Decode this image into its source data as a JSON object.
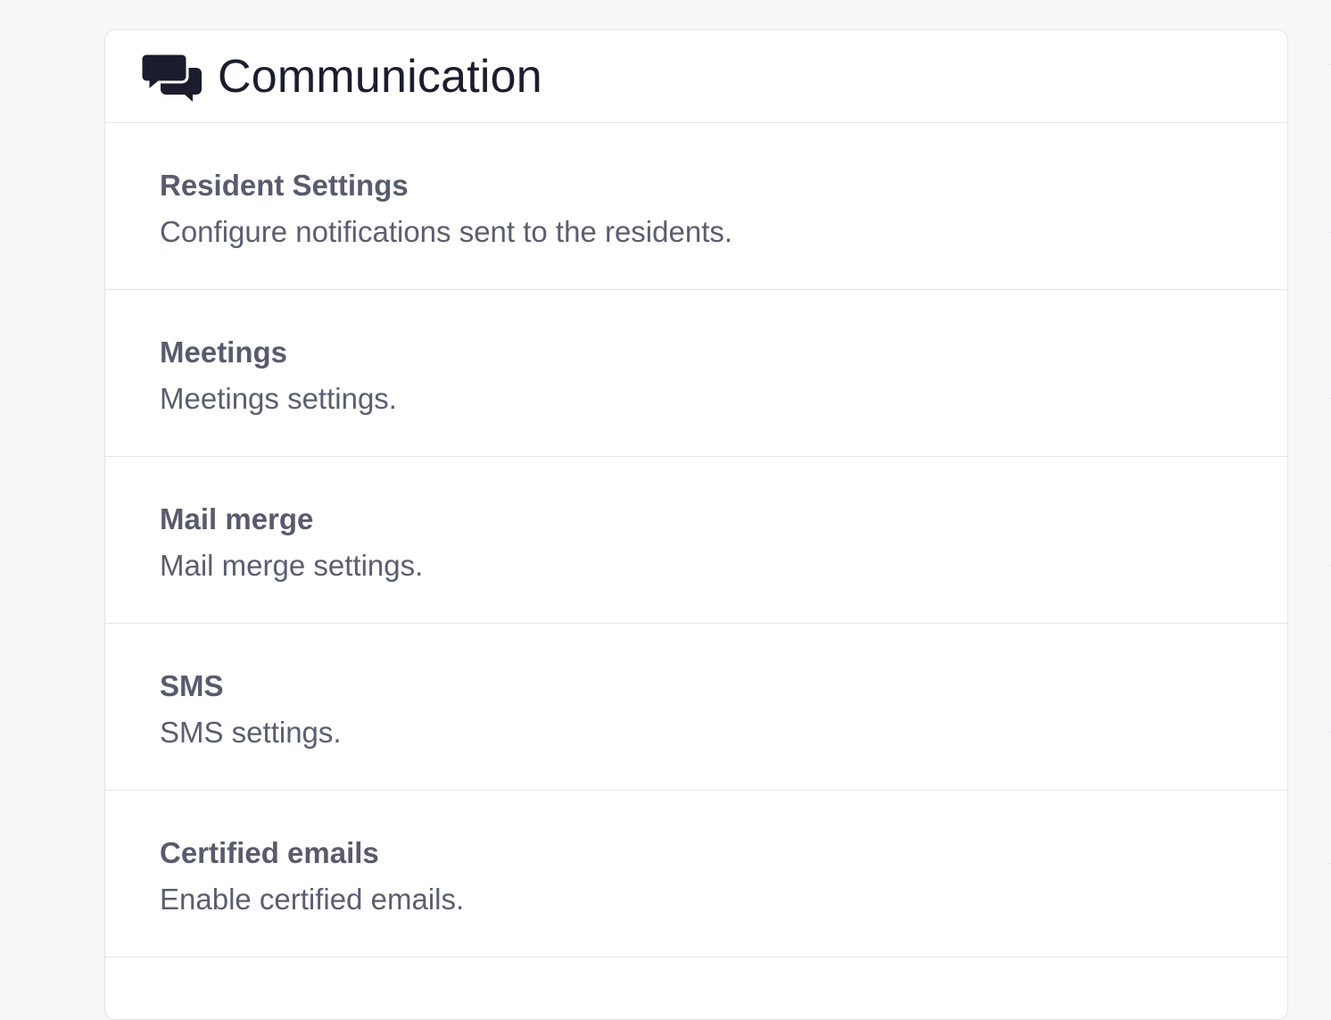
{
  "header": {
    "icon": "comments-icon",
    "title": "Communication"
  },
  "settings": [
    {
      "title": "Resident Settings",
      "description": "Configure notifications sent to the residents."
    },
    {
      "title": "Meetings",
      "description": "Meetings settings."
    },
    {
      "title": "Mail merge",
      "description": "Mail merge settings."
    },
    {
      "title": "SMS",
      "description": "SMS settings."
    },
    {
      "title": "Certified emails",
      "description": "Enable certified emails."
    }
  ],
  "colors": {
    "background": "#f6f7f9",
    "card": "#ffffff",
    "border": "#e3e5ea",
    "title_text": "#1b1d2e",
    "item_text": "#585b6e"
  }
}
